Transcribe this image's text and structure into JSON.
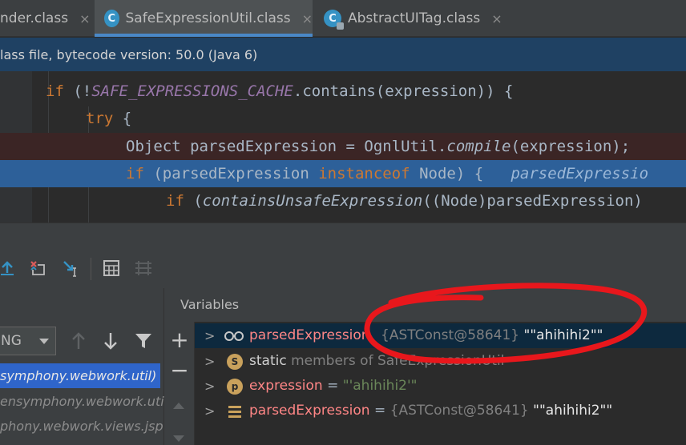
{
  "tabs": [
    {
      "label": "nder.class",
      "close": "×",
      "active": false
    },
    {
      "label": "SafeExpressionUtil.class",
      "close": "×",
      "active": true
    },
    {
      "label": "AbstractUITag.class",
      "close": "×",
      "active": false
    }
  ],
  "banner": {
    "text": "lass file, bytecode version: 50.0 (Java 6)"
  },
  "code": {
    "line1": {
      "kw_if": "if",
      "p1": " (!",
      "const": "SAFE_EXPRESSIONS_CACHE",
      "p2": ".contains(expression)) {"
    },
    "line2": {
      "kw_try": "try",
      "p1": " {"
    },
    "line3": {
      "p1": "Object parsedExpression = OgnlUtil.",
      "method": "compile",
      "p2": "(expression);"
    },
    "line4": {
      "kw_if": "if",
      "p1": " (parsedExpression ",
      "kw_instanceof": "instanceof",
      "p2": " Node) {",
      "inline": "parsedExpressio"
    },
    "line5": {
      "kw_if": "if",
      "p1": " (",
      "method": "containsUnsafeExpression",
      "p2": "((Node)parsedExpression)"
    }
  },
  "frames": {
    "thread_label": "NG",
    "rows": [
      {
        "text": "symphony.webwork.util)",
        "selected": true
      },
      {
        "text": "ensymphony.webwork.util",
        "selected": false
      },
      {
        "text": "phony.webwork.views.jsp",
        "selected": false
      }
    ]
  },
  "variables": {
    "header": "Variables",
    "rows": [
      {
        "chevron": ">",
        "icon": "watch-glasses-icon",
        "name": "parsedExpression",
        "value_ref": "{ASTConst@58641}",
        "value_str": "\"\"ahihihi2\"\""
      },
      {
        "chevron": ">",
        "icon_letter": "S",
        "name": "static",
        "value_ref": "members of SafeExpressionUtil"
      },
      {
        "chevron": ">",
        "icon_letter": "p",
        "name": "expression",
        "equals": " = ",
        "value_str": "\"'ahihihi2'\""
      },
      {
        "chevron": ">",
        "icon": "field-lines-icon",
        "name": "parsedExpression",
        "equals": " = ",
        "value_ref": "{ASTConst@58641}",
        "value_str": "\"\"ahihihi2\"\""
      }
    ]
  },
  "side_buttons": {
    "plus": "+",
    "minus": "−"
  },
  "colors": {
    "keyword": "#cc7832",
    "constant": "#9876aa",
    "exec_line": "#2d6099",
    "breakpoint_line": "#3b2525",
    "string": "#6a8759",
    "var_name": "#ff8686",
    "annotation_circle": "#e8171c"
  }
}
